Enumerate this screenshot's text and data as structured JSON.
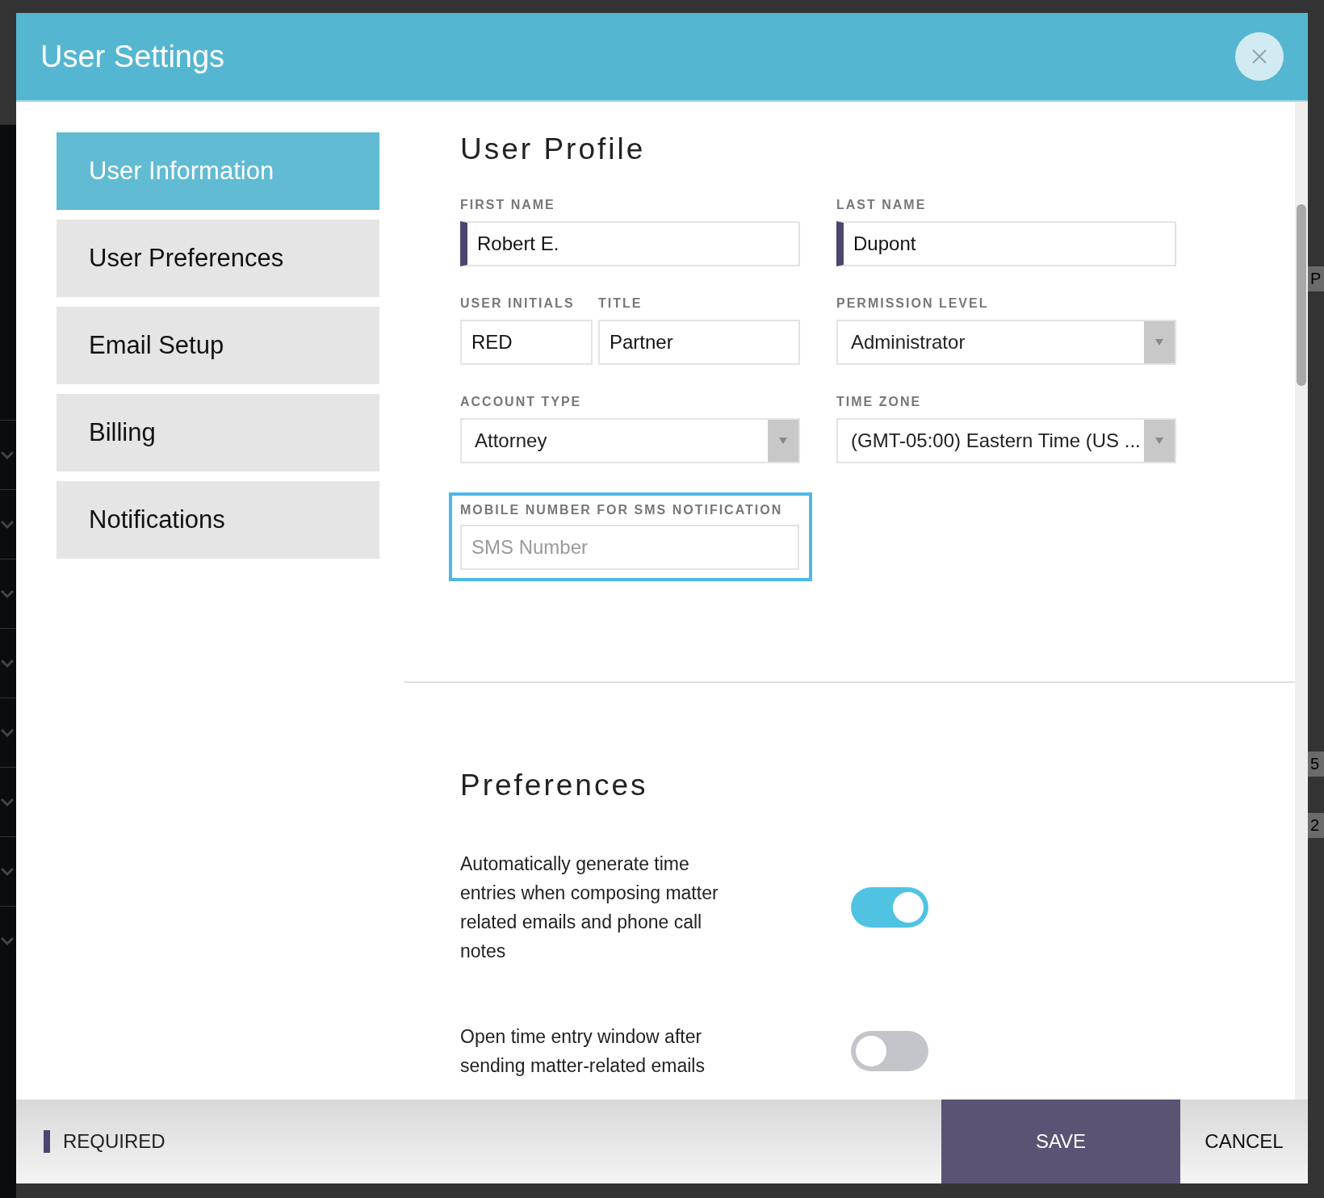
{
  "backdrop": {
    "right_fragments": [
      "P",
      "5",
      "2"
    ]
  },
  "window": {
    "title": "User Settings"
  },
  "sidebar": {
    "items": [
      {
        "label": "User Information",
        "selected": true
      },
      {
        "label": "User Preferences",
        "selected": false
      },
      {
        "label": "Email Setup",
        "selected": false
      },
      {
        "label": "Billing",
        "selected": false
      },
      {
        "label": "Notifications",
        "selected": false
      }
    ]
  },
  "profile": {
    "heading": "User Profile",
    "fields": [
      {
        "kind": "text",
        "label": "FIRST NAME",
        "value": "Robert E.",
        "required": true,
        "focused": false
      },
      {
        "kind": "text",
        "label": "LAST NAME",
        "value": "Dupont",
        "required": true,
        "focused": false
      },
      {
        "kind": "text",
        "label": "USER INITIALS",
        "value": "RED",
        "required": false,
        "focused": false
      },
      {
        "kind": "text",
        "label": "TITLE",
        "value": "Partner",
        "required": false,
        "focused": false
      },
      {
        "kind": "select",
        "label": "PERMISSION LEVEL",
        "value": "Administrator",
        "required": false,
        "focused": false
      },
      {
        "kind": "select",
        "label": "ACCOUNT TYPE",
        "value": "Attorney",
        "required": false,
        "focused": false
      },
      {
        "kind": "select",
        "label": "TIME ZONE",
        "value": "(GMT-05:00) Eastern Time (US ...",
        "required": false,
        "focused": false
      },
      {
        "kind": "text",
        "label": "MOBILE NUMBER FOR SMS NOTIFICATION",
        "placeholder": "SMS Number",
        "required": false,
        "focused": true
      }
    ]
  },
  "preferences": {
    "heading": "Preferences",
    "items": [
      {
        "text": "Automatically generate time entries when composing matter related emails and phone call notes",
        "on": true
      },
      {
        "text": "Open time entry window after sending matter-related emails",
        "on": false
      }
    ]
  },
  "footer": {
    "legend": "REQUIRED",
    "buttons": [
      {
        "label": "SAVE",
        "kind": "primary"
      },
      {
        "label": "CANCEL",
        "kind": "plain"
      }
    ]
  }
}
